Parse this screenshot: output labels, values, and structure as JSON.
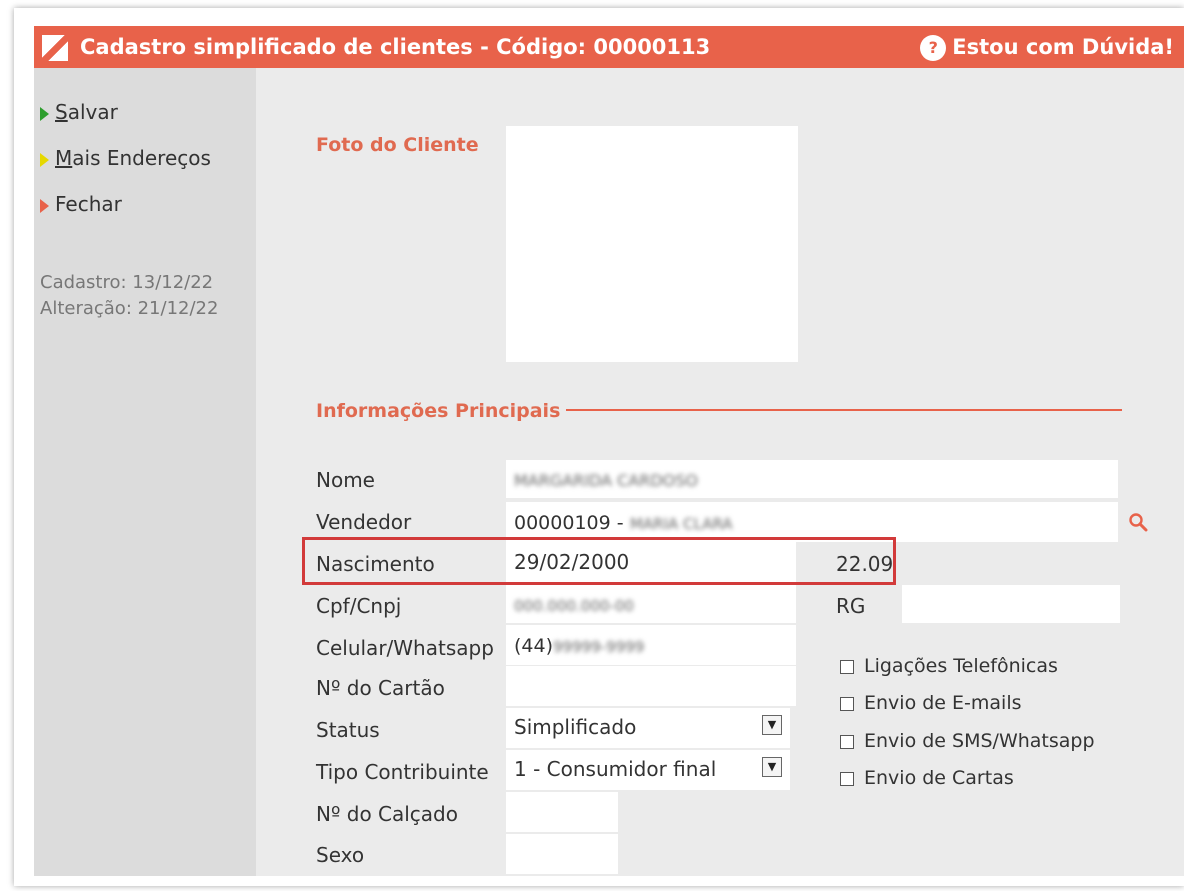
{
  "window": {
    "title": "Cadastro simplificado de clientes - Código: 00000113",
    "help_label": "Estou com Dúvida!",
    "help_icon": "question-bubble-icon",
    "accent_color": "#e8624a"
  },
  "sidebar": {
    "actions": [
      {
        "label": "Salvar",
        "shortcut_letter": "S",
        "color": "#2e9e2e"
      },
      {
        "label": "Mais Endereços",
        "shortcut_letter": "M",
        "color": "#e6d800"
      },
      {
        "label": "Fechar",
        "color": "#e8624a"
      }
    ],
    "cadastro": "Cadastro: 13/12/22",
    "alteracao": "Alteração: 21/12/22"
  },
  "photo_section": {
    "title": "Foto do Cliente"
  },
  "info_section": {
    "title": "Informações Principais"
  },
  "form": {
    "nome_label": "Nome",
    "nome_value": "MARGARIDA CARDOSO",
    "vendedor_label": "Vendedor",
    "vendedor_code": "00000109 -",
    "vendedor_name": "MARIA CLARA",
    "nascimento_label": "Nascimento",
    "nascimento_value": "29/02/2000",
    "idade_value": "22.09",
    "cpf_label": "Cpf/Cnpj",
    "cpf_value": "000.000.000-00",
    "rg_label": "RG",
    "rg_value": "",
    "celular_label": "Celular/Whatsapp",
    "celular_prefix": "(44)",
    "celular_number": "99999-9999",
    "cartao_label": "Nº do Cartão",
    "cartao_value": "",
    "status_label": "Status",
    "status_value": "Simplificado",
    "tipo_label": "Tipo Contribuinte",
    "tipo_value": "1 - Consumidor final",
    "calcado_label": "Nº do Calçado",
    "calcado_value": "",
    "sexo_label": "Sexo",
    "sexo_value": ""
  },
  "contact_prefs": [
    {
      "label": "Ligações Telefônicas",
      "checked": false
    },
    {
      "label": "Envio de E-mails",
      "checked": false
    },
    {
      "label": "Envio de SMS/Whatsapp",
      "checked": false
    },
    {
      "label": "Envio de Cartas",
      "checked": false
    }
  ]
}
